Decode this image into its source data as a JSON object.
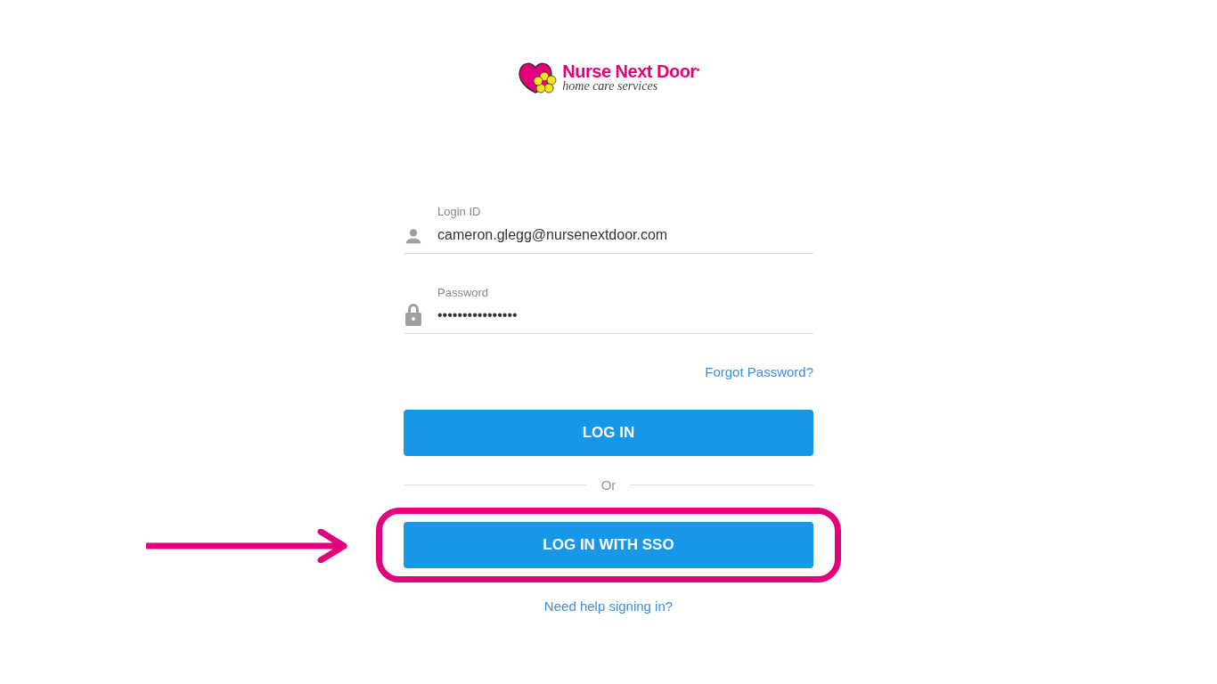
{
  "logo": {
    "name": "Nurse Next Door",
    "mark": "•",
    "tagline": "home care services"
  },
  "login_id": {
    "label": "Login ID",
    "value": "cameron.glegg@nursenextdoor.com"
  },
  "password": {
    "label": "Password",
    "value": "••••••••••••••••"
  },
  "forgot_link": "Forgot Password?",
  "login_button": "LOG IN",
  "divider": "Or",
  "sso_button": {
    "label": "LOG IN WITH SSO",
    "highlighted": true
  },
  "help_link": "Need help signing in?"
}
